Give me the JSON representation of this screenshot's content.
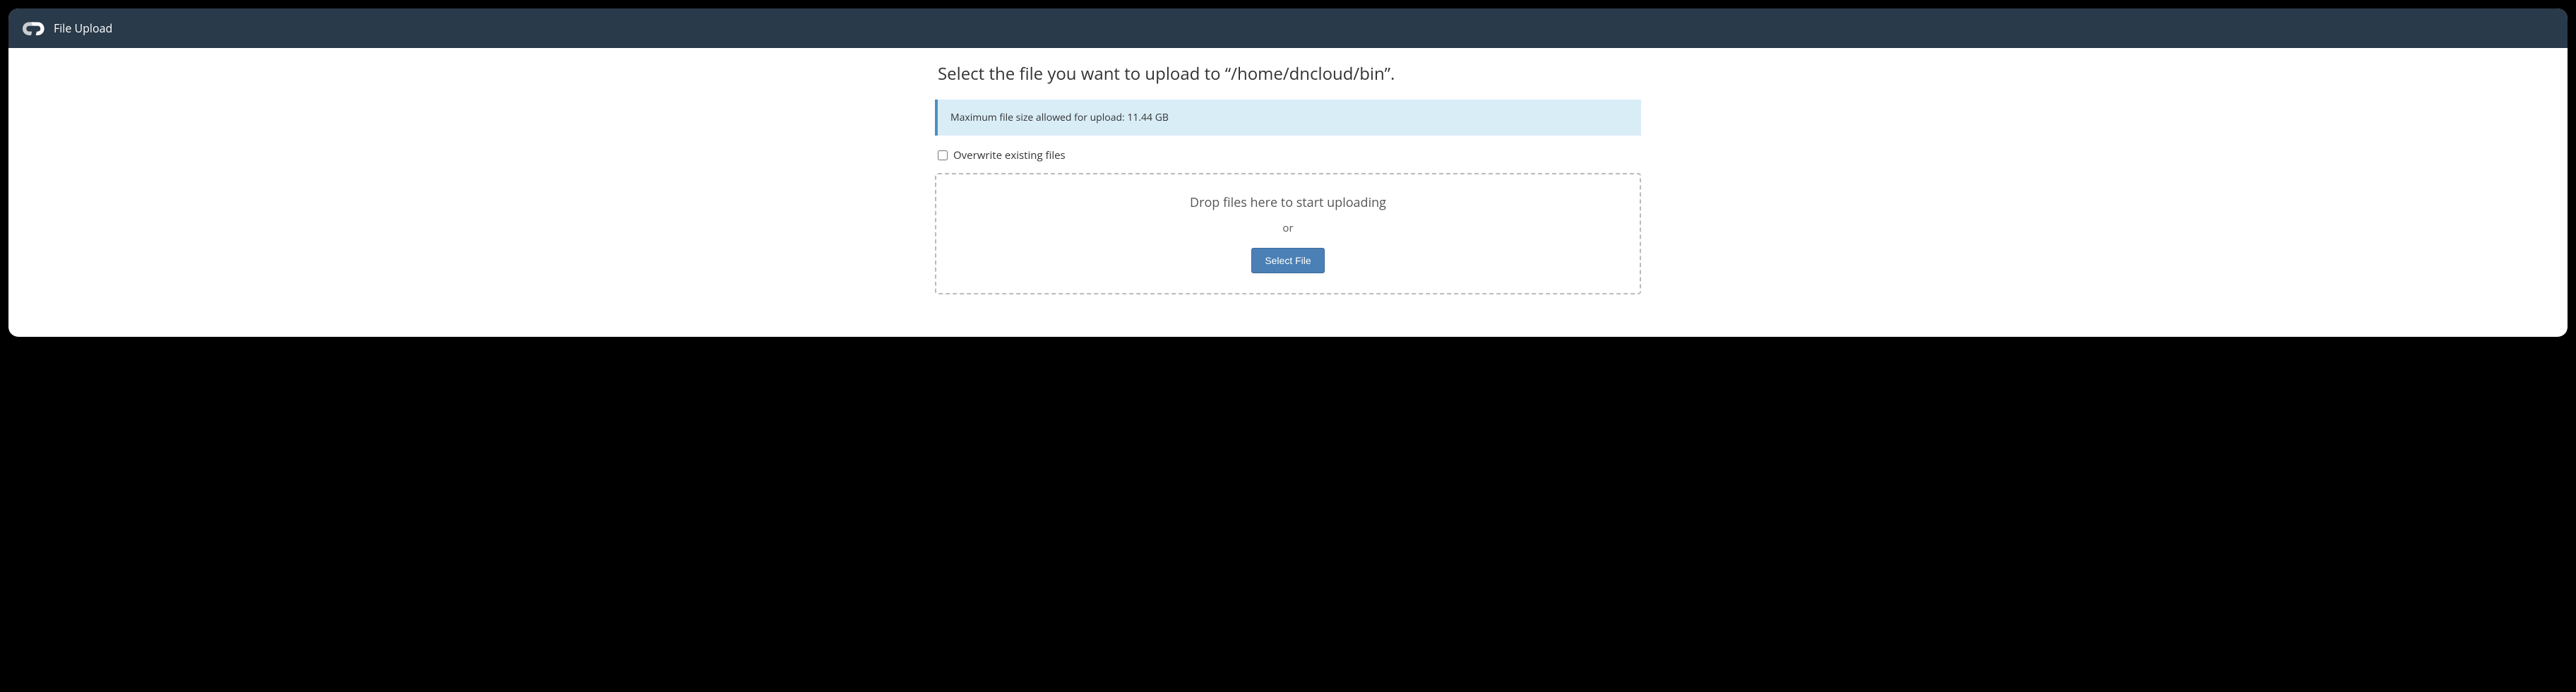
{
  "header": {
    "title": "File Upload"
  },
  "main": {
    "heading": "Select the file you want to upload to “/home/dncloud/bin”.",
    "info_message": "Maximum file size allowed for upload: 11.44 GB",
    "overwrite_label": "Overwrite existing files",
    "overwrite_checked": false,
    "dropzone": {
      "drop_text": "Drop files here to start uploading",
      "or_text": "or",
      "select_button": "Select File"
    }
  }
}
